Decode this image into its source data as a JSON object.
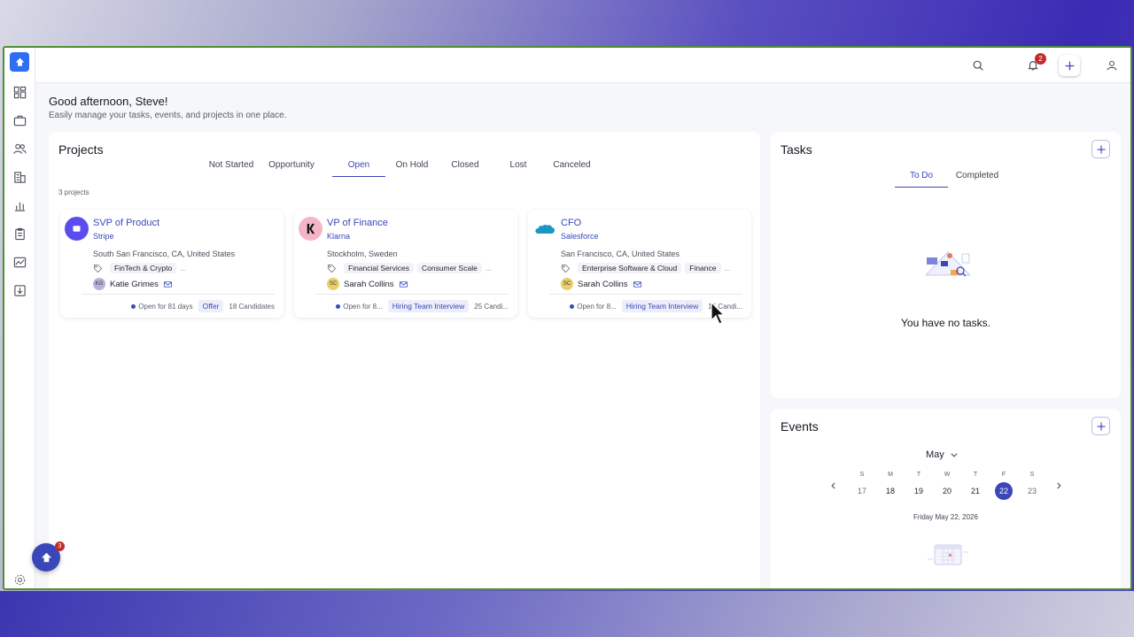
{
  "header": {
    "notification_count": "2",
    "icons": [
      "search-icon",
      "bell-icon",
      "plus-icon",
      "user-icon"
    ]
  },
  "greeting": {
    "title": "Good afternoon, Steve!",
    "subtitle": "Easily manage your tasks, events, and projects in one place."
  },
  "projects": {
    "title": "Projects",
    "tabs": [
      {
        "label": "Not Started"
      },
      {
        "label": "Opportunity"
      },
      {
        "label": "Open"
      },
      {
        "label": "On Hold"
      },
      {
        "label": "Closed"
      },
      {
        "label": "Lost"
      },
      {
        "label": "Canceled"
      }
    ],
    "active_tab": "Open",
    "count_label": "3 projects",
    "items": [
      {
        "title": "SVP of Product",
        "company": "Stripe",
        "location": "South San Francisco, CA, United States",
        "tags": [
          "FinTech & Crypto"
        ],
        "more_tags": "...",
        "owner": "Katie Grimes",
        "owner_initials": "KG",
        "open_for": "Open for 81 days",
        "stage": "Offer",
        "candidates": "18 Candidates"
      },
      {
        "title": "VP of Finance",
        "company": "Klarna",
        "location": "Stockholm, Sweden",
        "tags": [
          "Financial Services",
          "Consumer Scale"
        ],
        "more_tags": "...",
        "owner": "Sarah Collins",
        "owner_initials": "SC",
        "open_for": "Open for 8...",
        "stage": "Hiring Team Interview",
        "candidates": "25 Candi..."
      },
      {
        "title": "CFO",
        "company": "Salesforce",
        "location": "San Francisco, CA, United States",
        "tags": [
          "Enterprise Software & Cloud",
          "Finance"
        ],
        "more_tags": "...",
        "owner": "Sarah Collins",
        "owner_initials": "SC",
        "open_for": "Open for 8...",
        "stage": "Hiring Team Interview",
        "candidates": "16 Candi..."
      }
    ]
  },
  "tasks": {
    "title": "Tasks",
    "tabs": [
      {
        "label": "To Do"
      },
      {
        "label": "Completed"
      }
    ],
    "active_tab": "To Do",
    "empty_message": "You have no tasks."
  },
  "events": {
    "title": "Events",
    "month": "May",
    "weekdays": [
      "S",
      "M",
      "T",
      "W",
      "T",
      "F",
      "S"
    ],
    "days": [
      "17",
      "18",
      "19",
      "20",
      "21",
      "22",
      "23"
    ],
    "selected_day": "22",
    "full_date": "Friday May 22, 2026"
  },
  "fab": {
    "badge": "3"
  },
  "colors": {
    "accent": "#3a47b8",
    "brand_blue": "#2f6df2",
    "badge_red": "#c42b2b"
  }
}
